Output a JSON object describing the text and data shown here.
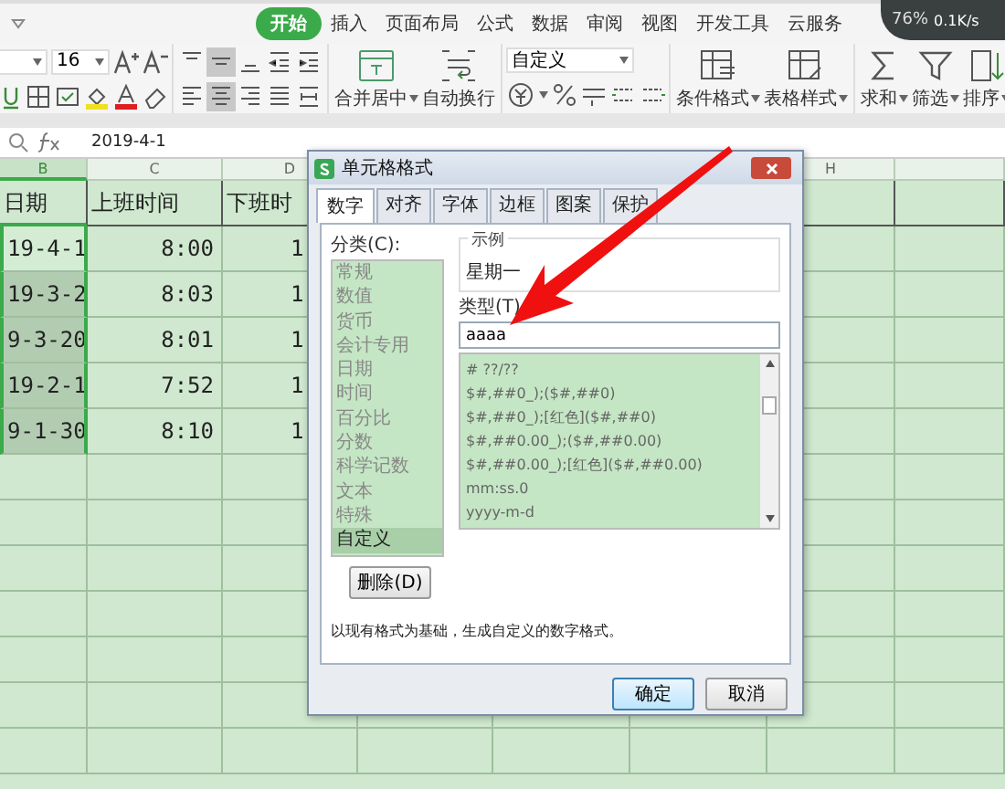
{
  "ribbon": {
    "tabs": [
      {
        "label": "开始",
        "selected": true
      },
      {
        "label": "插入",
        "selected": false
      },
      {
        "label": "页面布局",
        "selected": false
      },
      {
        "label": "公式",
        "selected": false
      },
      {
        "label": "数据",
        "selected": false
      },
      {
        "label": "审阅",
        "selected": false
      },
      {
        "label": "视图",
        "selected": false
      },
      {
        "label": "开发工具",
        "selected": false
      },
      {
        "label": "云服务",
        "selected": false
      }
    ],
    "font_size": "16",
    "number_format": "自定义",
    "buttons": [
      {
        "label": "合并居中",
        "dropdown": true
      },
      {
        "label": "自动换行",
        "dropdown": false
      }
    ],
    "style_buttons": [
      {
        "label": "条件格式",
        "dropdown": true
      },
      {
        "label": "表格样式",
        "dropdown": true
      }
    ],
    "edit_buttons": [
      {
        "label": "求和",
        "dropdown": true
      },
      {
        "label": "筛选",
        "dropdown": true
      },
      {
        "label": "排序",
        "dropdown": true
      }
    ],
    "widget": {
      "percent": "76%",
      "speed": "0.1K/s"
    }
  },
  "formula_bar": {
    "value": "2019-4-1"
  },
  "sheet": {
    "columns": [
      {
        "letter": "B",
        "selected": true
      },
      {
        "letter": "C",
        "selected": false
      },
      {
        "letter": "D",
        "selected": false
      },
      {
        "letter": "H",
        "selected": false
      }
    ],
    "rows": [
      {
        "cells": [
          "日期",
          "上班时间",
          "下班时"
        ]
      },
      {
        "cells": [
          "19-4-1",
          "8:00",
          "1"
        ]
      },
      {
        "cells": [
          "19-3-2",
          "8:03",
          "1"
        ]
      },
      {
        "cells": [
          "9-3-20",
          "8:01",
          "1"
        ]
      },
      {
        "cells": [
          "19-2-1",
          "7:52",
          "1"
        ]
      },
      {
        "cells": [
          "9-1-30",
          "8:10",
          "1"
        ]
      }
    ]
  },
  "dialog": {
    "title": "单元格格式",
    "tabs": [
      {
        "label": "数字",
        "selected": true
      },
      {
        "label": "对齐",
        "selected": false
      },
      {
        "label": "字体",
        "selected": false
      },
      {
        "label": "边框",
        "selected": false
      },
      {
        "label": "图案",
        "selected": false
      },
      {
        "label": "保护",
        "selected": false
      }
    ],
    "category_label": "分类(C):",
    "categories": [
      {
        "label": "常规",
        "selected": false
      },
      {
        "label": "数值",
        "selected": false
      },
      {
        "label": "货币",
        "selected": false
      },
      {
        "label": "会计专用",
        "selected": false
      },
      {
        "label": "日期",
        "selected": false
      },
      {
        "label": "时间",
        "selected": false
      },
      {
        "label": "百分比",
        "selected": false
      },
      {
        "label": "分数",
        "selected": false
      },
      {
        "label": "科学记数",
        "selected": false
      },
      {
        "label": "文本",
        "selected": false
      },
      {
        "label": "特殊",
        "selected": false
      },
      {
        "label": "自定义",
        "selected": true
      }
    ],
    "sample_label": "示例",
    "sample_value": "星期一",
    "type_label": "类型(T):",
    "type_value": "aaaa",
    "formats": [
      "# ??/??",
      "$#,##0_);($#,##0)",
      "$#,##0_);[红色]($#,##0)",
      "$#,##0.00_);($#,##0.00)",
      "$#,##0.00_);[红色]($#,##0.00)",
      "mm:ss.0",
      "yyyy-m-d"
    ],
    "delete_button": "删除(D)",
    "description": "以现有格式为基础，生成自定义的数字格式。",
    "buttons": [
      {
        "label": "确定",
        "selected": true
      },
      {
        "label": "取消",
        "selected": false
      }
    ]
  }
}
